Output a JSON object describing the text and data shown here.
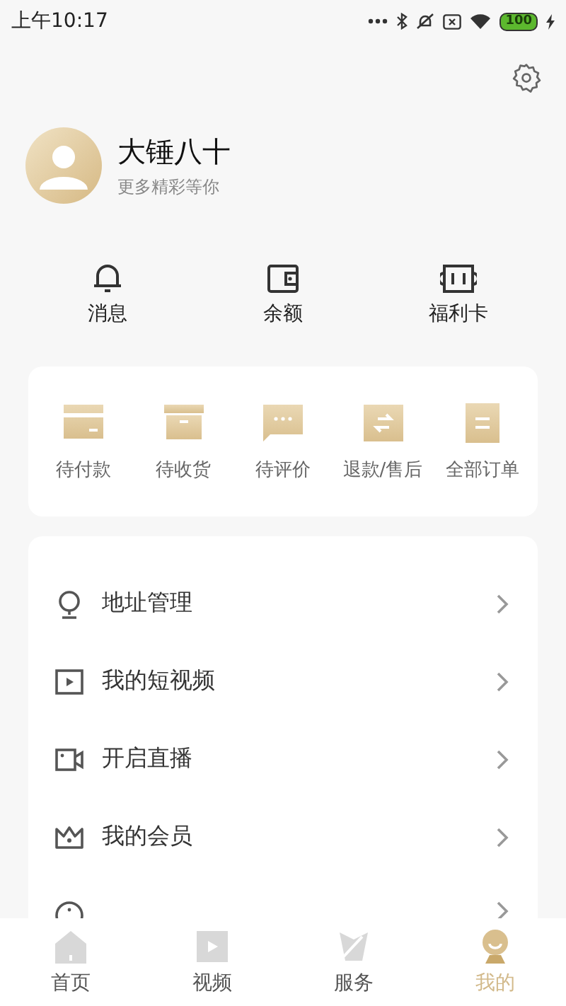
{
  "status_bar": {
    "time": "上午10:17",
    "battery": "100"
  },
  "profile": {
    "name": "大锤八十",
    "subtitle": "更多精彩等你"
  },
  "shortcuts": [
    {
      "kind": "bell",
      "label": "消息"
    },
    {
      "kind": "wallet",
      "label": "余额"
    },
    {
      "kind": "card",
      "label": "福利卡"
    }
  ],
  "orders": [
    {
      "kind": "pay",
      "label": "待付款"
    },
    {
      "kind": "box",
      "label": "待收货"
    },
    {
      "kind": "comment",
      "label": "待评价"
    },
    {
      "kind": "refund",
      "label": "退款/售后"
    },
    {
      "kind": "all",
      "label": "全部订单"
    }
  ],
  "menu": [
    {
      "kind": "pin",
      "label": "地址管理"
    },
    {
      "kind": "play",
      "label": "我的短视频"
    },
    {
      "kind": "camera",
      "label": "开启直播"
    },
    {
      "kind": "crown",
      "label": "我的会员"
    },
    {
      "kind": "info"
    }
  ],
  "tabs": [
    {
      "kind": "home",
      "label": "首页",
      "selected": false
    },
    {
      "kind": "video",
      "label": "视频",
      "selected": false
    },
    {
      "kind": "service",
      "label": "服务",
      "selected": false
    },
    {
      "kind": "me",
      "label": "我的",
      "selected": true
    }
  ]
}
